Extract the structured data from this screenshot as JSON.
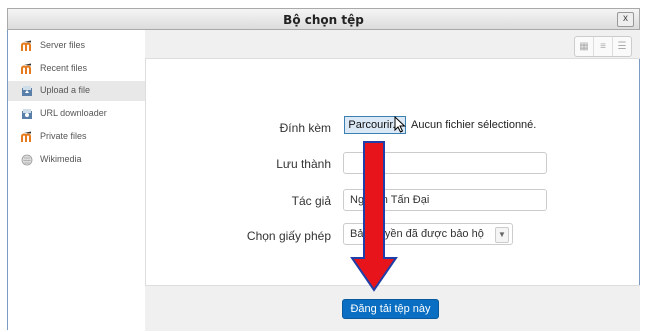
{
  "dialog": {
    "title": "Bộ chọn tệp",
    "close_label": "x"
  },
  "sidebar": {
    "items": [
      {
        "label": "Server files",
        "icon": "moodle-icon"
      },
      {
        "label": "Recent files",
        "icon": "moodle-icon"
      },
      {
        "label": "Upload a file",
        "icon": "upload-icon"
      },
      {
        "label": "URL downloader",
        "icon": "url-icon"
      },
      {
        "label": "Private files",
        "icon": "moodle-icon"
      },
      {
        "label": "Wikimedia",
        "icon": "wikimedia-icon"
      }
    ]
  },
  "toolbar": {
    "view_icons": [
      "grid-view-icon",
      "list-view-icon",
      "tree-view-icon"
    ]
  },
  "form": {
    "attachment_label": "Đính kèm",
    "browse_label": "Parcourir...",
    "no_file_text": "Aucun fichier sélectionné.",
    "save_as_label": "Lưu thành",
    "save_as_value": "",
    "author_label": "Tác giả",
    "author_value": "Nguyễn Tấn Đại",
    "license_label": "Chọn giấy phép",
    "license_value": "Bản quyền đã được bảo hộ"
  },
  "footer": {
    "upload_button": "Đăng tải tệp này"
  },
  "colors": {
    "arrow": "#e8141b",
    "arrow_outline": "#1f3ea8",
    "primary_button": "#0a6fc2"
  }
}
